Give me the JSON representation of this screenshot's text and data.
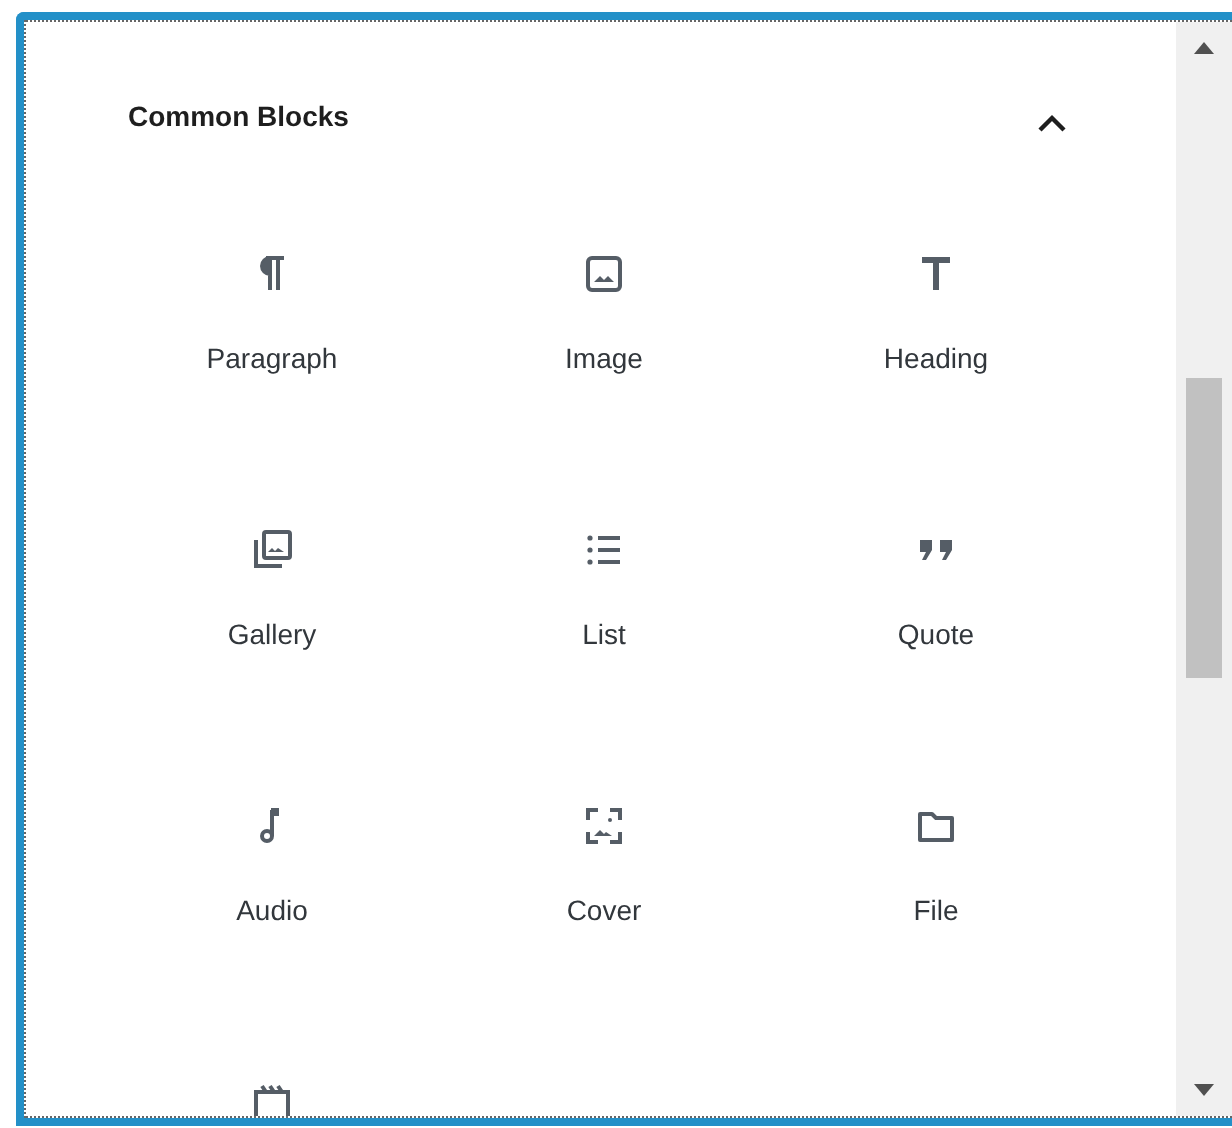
{
  "panel": {
    "title": "Common Blocks",
    "expanded": true
  },
  "blocks": [
    {
      "kind": "paragraph",
      "label": "Paragraph"
    },
    {
      "kind": "image",
      "label": "Image"
    },
    {
      "kind": "heading",
      "label": "Heading"
    },
    {
      "kind": "gallery",
      "label": "Gallery"
    },
    {
      "kind": "list",
      "label": "List"
    },
    {
      "kind": "quote",
      "label": "Quote"
    },
    {
      "kind": "audio",
      "label": "Audio"
    },
    {
      "kind": "cover",
      "label": "Cover"
    },
    {
      "kind": "file",
      "label": "File"
    },
    {
      "kind": "video"
    }
  ]
}
